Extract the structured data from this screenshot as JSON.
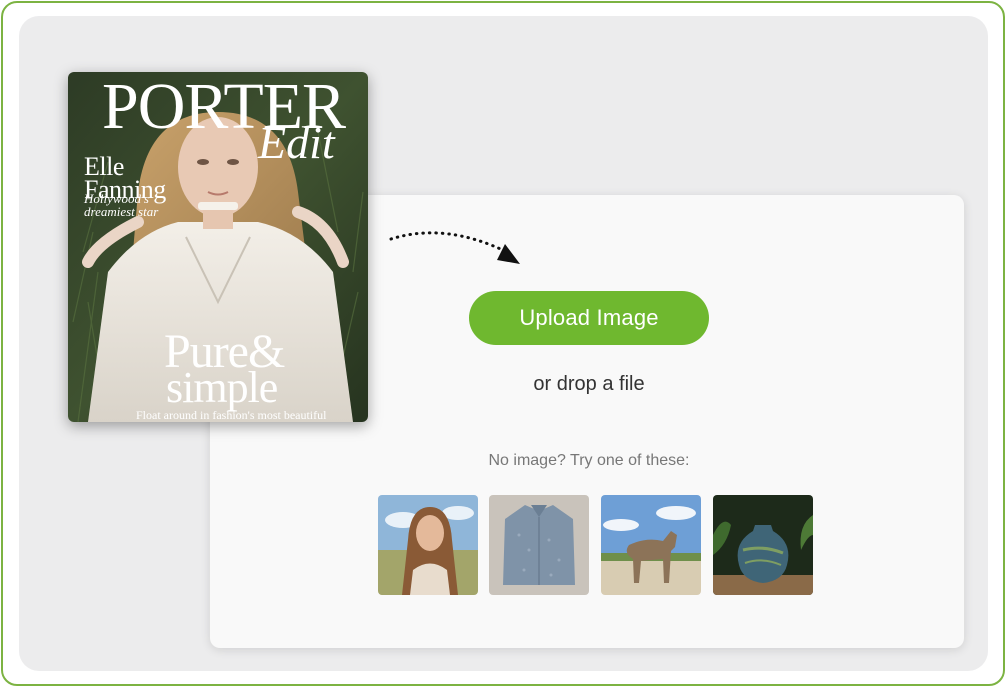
{
  "upload": {
    "button_label": "Upload Image",
    "drop_text": "or drop a file",
    "samples_prompt": "No image? Try one of these:"
  },
  "samples": [
    {
      "name": "woman-in-field"
    },
    {
      "name": "denim-shirt"
    },
    {
      "name": "wolf"
    },
    {
      "name": "ceramic-vase"
    }
  ],
  "cover": {
    "masthead": "PORTER",
    "masthead_sub": "Edit",
    "cover_name": "Elle\nFanning",
    "tagline": "Hollywood's\ndreamiest star",
    "headline_1": "Pure&",
    "headline_2": "simple",
    "blurb": "Float around in fashion's most beautiful"
  },
  "colors": {
    "accent": "#6fb82f",
    "frame_border": "#7cb342",
    "background": "#ececed",
    "card": "#f9f9f9"
  },
  "icons": [
    "dotted-curved-arrow-icon"
  ]
}
